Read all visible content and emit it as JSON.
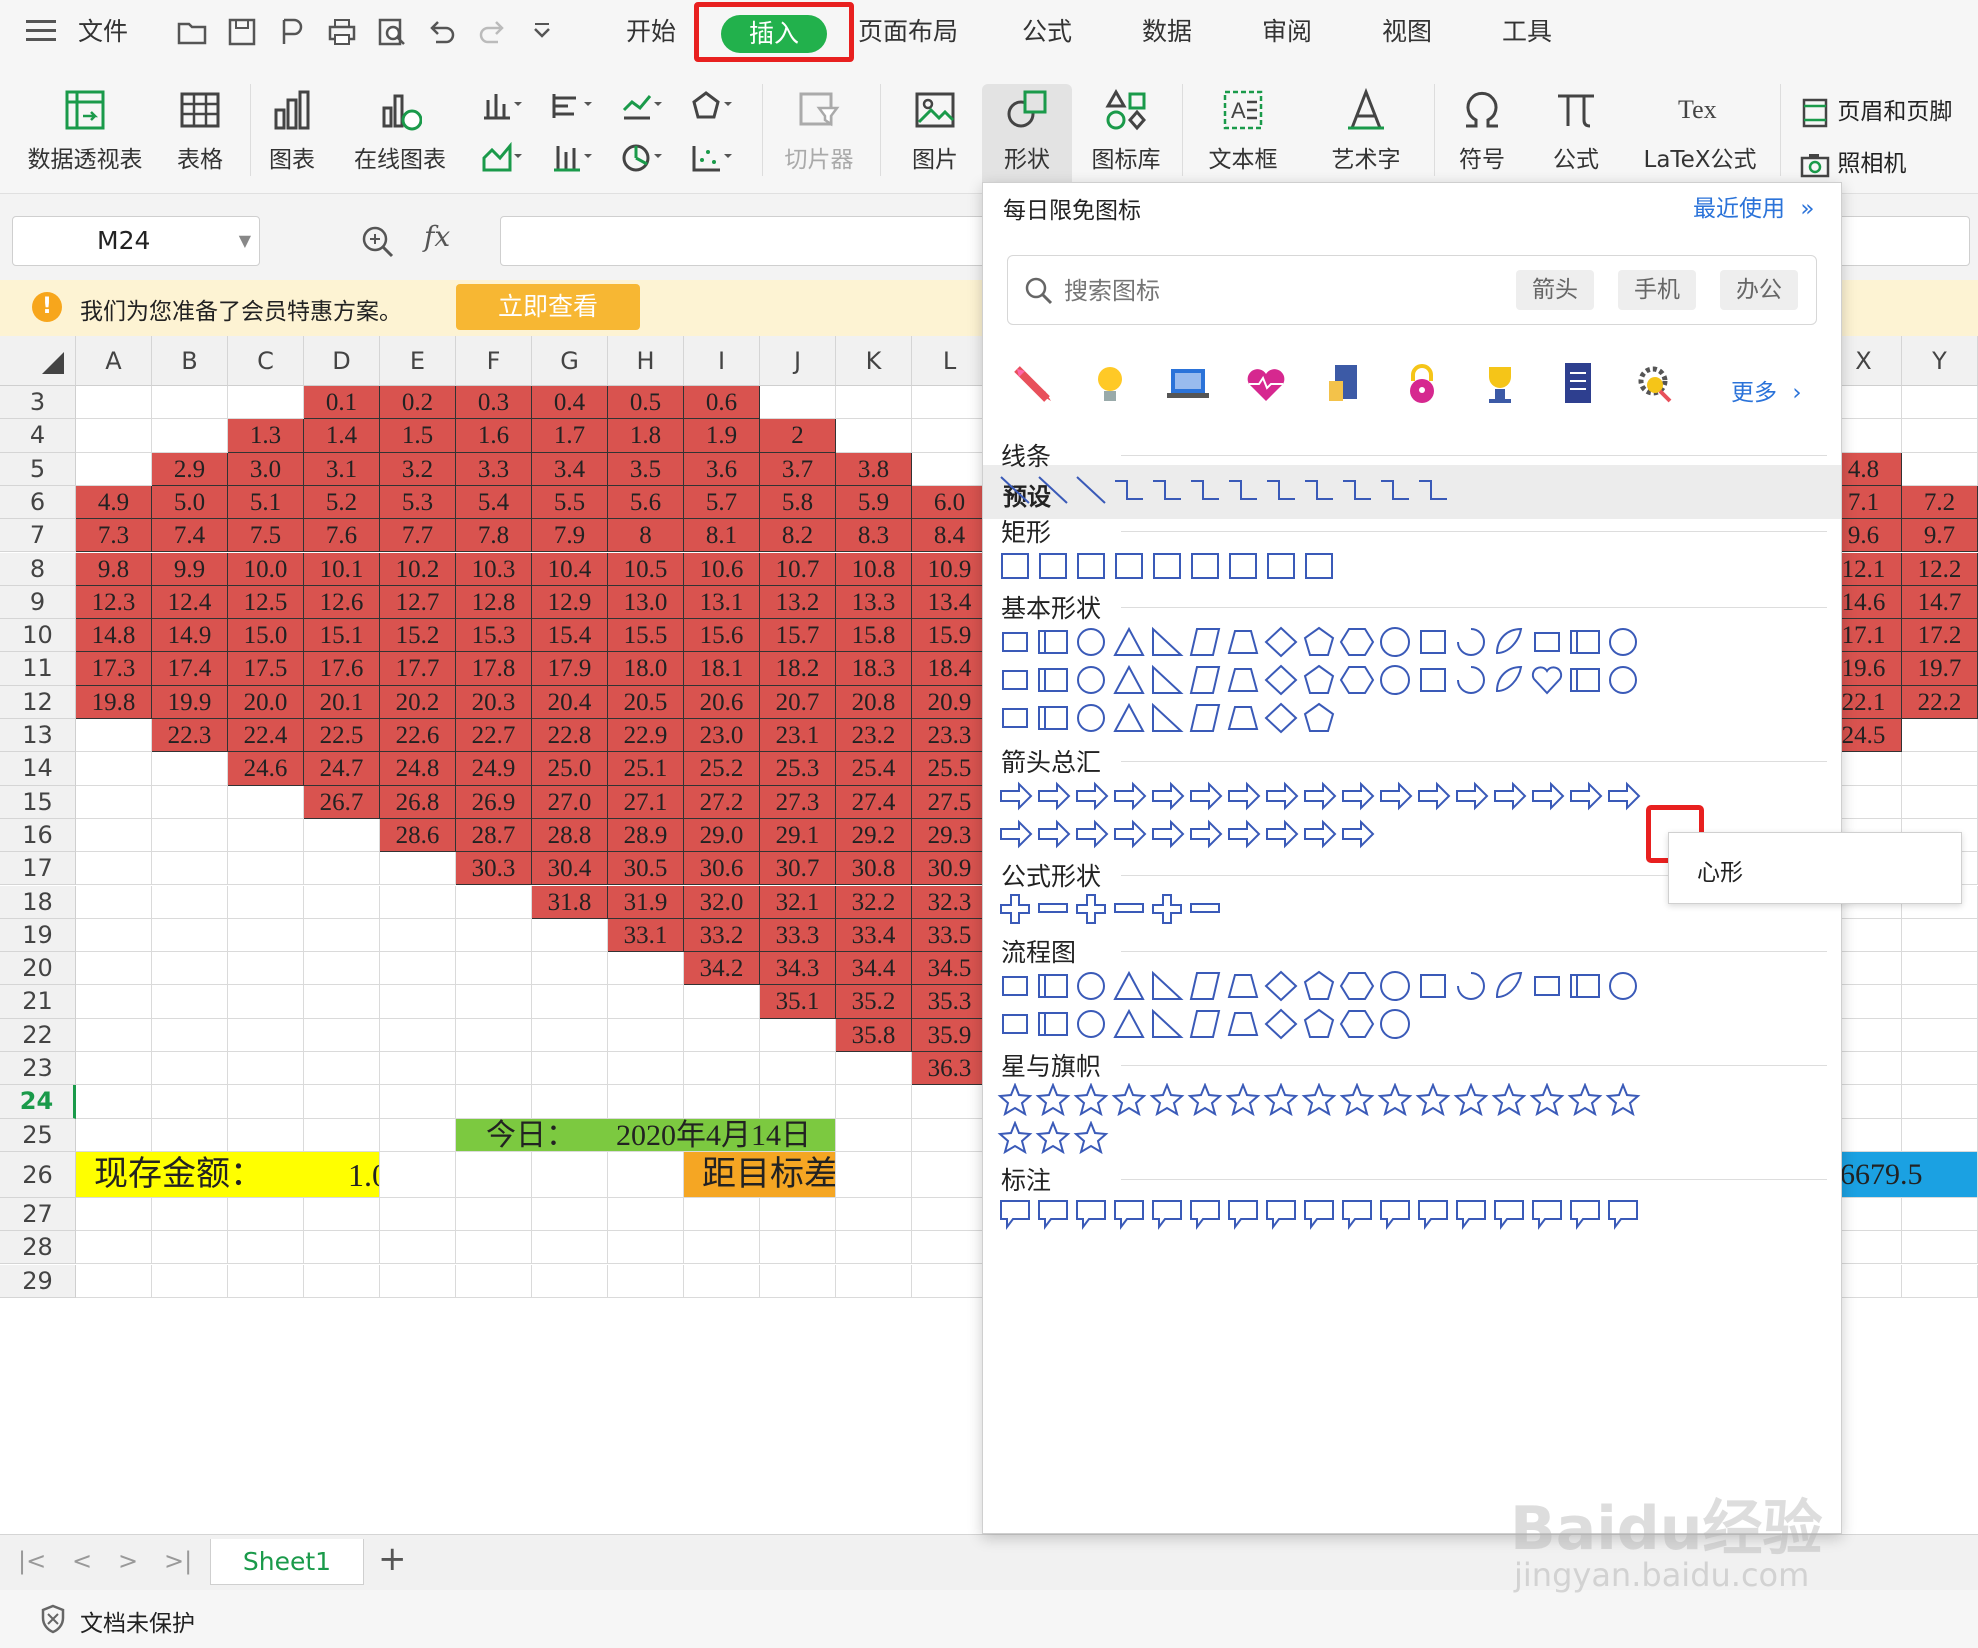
{
  "menubar": {
    "file": "文件",
    "tabs": [
      "开始",
      "插入",
      "页面布局",
      "公式",
      "数据",
      "审阅",
      "视图",
      "工具"
    ],
    "active_tab": "插入"
  },
  "ribbon": {
    "pivot": "数据透视表",
    "table": "表格",
    "chart": "图表",
    "online_chart": "在线图表",
    "slicer": "切片器",
    "picture": "图片",
    "shape": "形状",
    "icon_lib": "图标库",
    "textbox": "文本框",
    "wordart": "艺术字",
    "symbol": "符号",
    "formula": "公式",
    "latex": "LaTeX公式",
    "header_footer": "页眉和页脚",
    "camera": "照相机"
  },
  "formula_bar": {
    "cell_ref": "M24",
    "fx": "fx"
  },
  "notice": {
    "text": "我们为您准备了会员特惠方案。",
    "button": "立即查看"
  },
  "grid": {
    "columns_left": [
      "A",
      "B",
      "C",
      "D",
      "E",
      "F",
      "G",
      "H",
      "I",
      "J",
      "K",
      "L"
    ],
    "columns_right": [
      "X",
      "Y"
    ],
    "rows": [
      3,
      4,
      5,
      6,
      7,
      8,
      9,
      10,
      11,
      12,
      13,
      14,
      15,
      16,
      17,
      18,
      19,
      20,
      21,
      22,
      23,
      24,
      25,
      26,
      27,
      28,
      29
    ],
    "red_rows": [
      {
        "row": 3,
        "start": 3,
        "vals": [
          "0.1",
          "0.2",
          "0.3",
          "0.4",
          "0.5",
          "0.6"
        ]
      },
      {
        "row": 4,
        "start": 2,
        "vals": [
          "1.3",
          "1.4",
          "1.5",
          "1.6",
          "1.7",
          "1.8",
          "1.9",
          "2"
        ]
      },
      {
        "row": 5,
        "start": 1,
        "vals": [
          "2.9",
          "3.0",
          "3.1",
          "3.2",
          "3.3",
          "3.4",
          "3.5",
          "3.6",
          "3.7",
          "3.8"
        ]
      },
      {
        "row": 6,
        "start": 0,
        "vals": [
          "4.9",
          "5.0",
          "5.1",
          "5.2",
          "5.3",
          "5.4",
          "5.5",
          "5.6",
          "5.7",
          "5.8",
          "5.9",
          "6.0"
        ]
      },
      {
        "row": 7,
        "start": 0,
        "vals": [
          "7.3",
          "7.4",
          "7.5",
          "7.6",
          "7.7",
          "7.8",
          "7.9",
          "8",
          "8.1",
          "8.2",
          "8.3",
          "8.4"
        ]
      },
      {
        "row": 8,
        "start": 0,
        "vals": [
          "9.8",
          "9.9",
          "10.0",
          "10.1",
          "10.2",
          "10.3",
          "10.4",
          "10.5",
          "10.6",
          "10.7",
          "10.8",
          "10.9"
        ]
      },
      {
        "row": 9,
        "start": 0,
        "vals": [
          "12.3",
          "12.4",
          "12.5",
          "12.6",
          "12.7",
          "12.8",
          "12.9",
          "13.0",
          "13.1",
          "13.2",
          "13.3",
          "13.4"
        ]
      },
      {
        "row": 10,
        "start": 0,
        "vals": [
          "14.8",
          "14.9",
          "15.0",
          "15.1",
          "15.2",
          "15.3",
          "15.4",
          "15.5",
          "15.6",
          "15.7",
          "15.8",
          "15.9"
        ]
      },
      {
        "row": 11,
        "start": 0,
        "vals": [
          "17.3",
          "17.4",
          "17.5",
          "17.6",
          "17.7",
          "17.8",
          "17.9",
          "18.0",
          "18.1",
          "18.2",
          "18.3",
          "18.4"
        ]
      },
      {
        "row": 12,
        "start": 0,
        "vals": [
          "19.8",
          "19.9",
          "20.0",
          "20.1",
          "20.2",
          "20.3",
          "20.4",
          "20.5",
          "20.6",
          "20.7",
          "20.8",
          "20.9"
        ]
      },
      {
        "row": 13,
        "start": 1,
        "vals": [
          "22.3",
          "22.4",
          "22.5",
          "22.6",
          "22.7",
          "22.8",
          "22.9",
          "23.0",
          "23.1",
          "23.2",
          "23.3"
        ]
      },
      {
        "row": 14,
        "start": 2,
        "vals": [
          "24.6",
          "24.7",
          "24.8",
          "24.9",
          "25.0",
          "25.1",
          "25.2",
          "25.3",
          "25.4",
          "25.5"
        ]
      },
      {
        "row": 15,
        "start": 3,
        "vals": [
          "26.7",
          "26.8",
          "26.9",
          "27.0",
          "27.1",
          "27.2",
          "27.3",
          "27.4",
          "27.5"
        ]
      },
      {
        "row": 16,
        "start": 4,
        "vals": [
          "28.6",
          "28.7",
          "28.8",
          "28.9",
          "29.0",
          "29.1",
          "29.2",
          "29.3"
        ]
      },
      {
        "row": 17,
        "start": 5,
        "vals": [
          "30.3",
          "30.4",
          "30.5",
          "30.6",
          "30.7",
          "30.8",
          "30.9"
        ]
      },
      {
        "row": 18,
        "start": 6,
        "vals": [
          "31.8",
          "31.9",
          "32.0",
          "32.1",
          "32.2",
          "32.3"
        ]
      },
      {
        "row": 19,
        "start": 7,
        "vals": [
          "33.1",
          "33.2",
          "33.3",
          "33.4",
          "33.5"
        ]
      },
      {
        "row": 20,
        "start": 8,
        "vals": [
          "34.2",
          "34.3",
          "34.4",
          "34.5"
        ]
      },
      {
        "row": 21,
        "start": 9,
        "vals": [
          "35.1",
          "35.2",
          "35.3"
        ]
      },
      {
        "row": 22,
        "start": 10,
        "vals": [
          "35.8",
          "35.9"
        ]
      },
      {
        "row": 23,
        "start": 11,
        "vals": [
          "36.3"
        ]
      }
    ],
    "right_red": [
      {
        "row": 5,
        "vals": [
          "4.8",
          ""
        ]
      },
      {
        "row": 6,
        "vals": [
          "7.1",
          "7.2"
        ]
      },
      {
        "row": 7,
        "vals": [
          "9.6",
          "9.7"
        ]
      },
      {
        "row": 8,
        "vals": [
          "12.1",
          "12.2"
        ]
      },
      {
        "row": 9,
        "vals": [
          "14.6",
          "14.7"
        ]
      },
      {
        "row": 10,
        "vals": [
          "17.1",
          "17.2"
        ]
      },
      {
        "row": 11,
        "vals": [
          "19.6",
          "19.7"
        ]
      },
      {
        "row": 12,
        "vals": [
          "22.1",
          "22.2"
        ]
      },
      {
        "row": 13,
        "vals": [
          "24.5",
          ""
        ]
      }
    ],
    "today_label": "今日：",
    "today_value": "2020年4月14日",
    "balance_label": "现存金额：",
    "balance_value": "1.0",
    "target_label": "距目标差",
    "target_value": "6679.5",
    "colors": {
      "red": "#d9534f",
      "green": "#7cc940",
      "yellow": "#ffff00",
      "orange": "#f5a623",
      "blue": "#1ba1e2"
    }
  },
  "sheet_tabs": {
    "sheet": "Sheet1",
    "add": "+"
  },
  "status": {
    "protect": "文档未保护"
  },
  "panel": {
    "daily_title": "每日限免图标",
    "recent": "最近使用",
    "search_placeholder": "搜索图标",
    "chips": [
      "箭头",
      "手机",
      "办公"
    ],
    "more": "更多",
    "preset": "预设",
    "sections": [
      "线条",
      "矩形",
      "基本形状",
      "箭头总汇",
      "公式形状",
      "流程图",
      "星与旗帜",
      "标注"
    ],
    "tooltip": "心形"
  },
  "watermark": {
    "logo": "Baidu经验",
    "url": "jingyan.baidu.com"
  }
}
